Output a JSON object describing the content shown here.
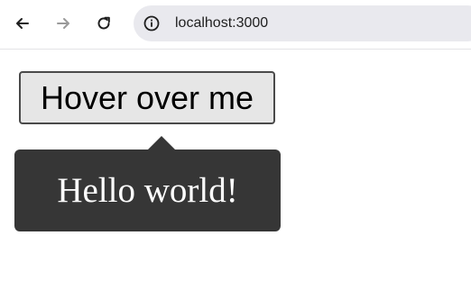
{
  "browser": {
    "url": "localhost:3000",
    "icons": {
      "back": "arrow-left-icon",
      "forward": "arrow-right-icon",
      "reload": "reload-icon",
      "site_info": "info-icon"
    }
  },
  "page": {
    "button_label": "Hover over me",
    "tooltip_text": "Hello world!"
  },
  "colors": {
    "tooltip_bg": "#363636",
    "button_bg": "#e6e6e6",
    "omnibox_bg": "#e9e9ee"
  }
}
